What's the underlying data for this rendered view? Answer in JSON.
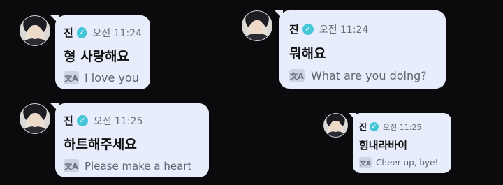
{
  "messages": [
    {
      "sender": "진",
      "time": "오전 11:24",
      "korean": "형 사랑해요",
      "translation": "I love you"
    },
    {
      "sender": "진",
      "time": "오전 11:24",
      "korean": "뭐해요",
      "translation": "What are you doing?"
    },
    {
      "sender": "진",
      "time": "오전 11:25",
      "korean": "하트해주세요",
      "translation": "Please make a heart"
    },
    {
      "sender": "진",
      "time": "오전 11:25",
      "korean": "힘내라바이",
      "translation": "Cheer up, bye!"
    }
  ],
  "icons": {
    "verified": "check-badge-icon",
    "translate": "translate-icon"
  },
  "colors": {
    "background": "#0b0b0d",
    "bubble": "#e8edfc",
    "verified": "#45c7d8"
  }
}
